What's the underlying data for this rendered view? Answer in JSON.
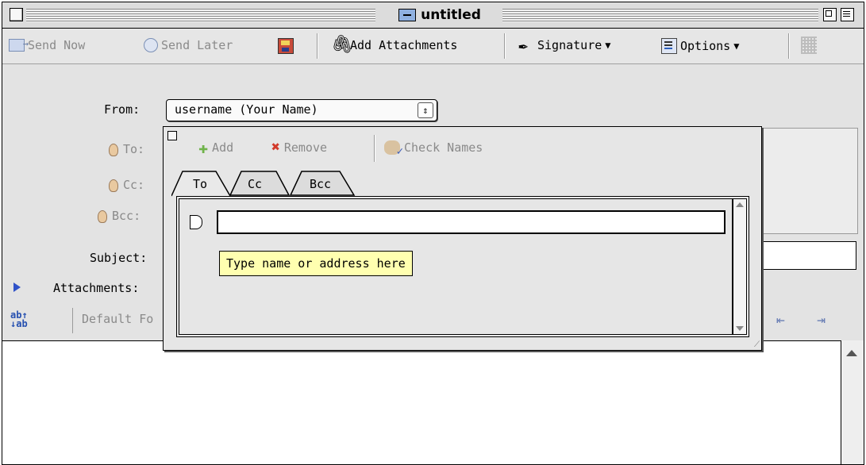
{
  "window": {
    "title": "untitled"
  },
  "toolbar": {
    "send_now": "Send Now",
    "send_later": "Send Later",
    "add_attachments": "Add Attachments",
    "signature": "Signature",
    "options": "Options",
    "dropdown_caret": "▼"
  },
  "header": {
    "from_label": "From:",
    "from_value": "username (Your Name)",
    "to_label": "To:",
    "cc_label": "Cc:",
    "bcc_label": "Bcc:",
    "subject_label": "Subject:",
    "attachments_label": "Attachments:"
  },
  "format_bar": {
    "font_value": "Default Fo"
  },
  "address_palette": {
    "add": "Add",
    "remove": "Remove",
    "check_names": "Check Names",
    "tabs": [
      {
        "label": "To"
      },
      {
        "label": "Cc"
      },
      {
        "label": "Bcc"
      }
    ],
    "active_tab": "To",
    "address_input": {
      "value": "",
      "placeholder": "Type name or address here"
    },
    "tooltip": "Type name or address here"
  },
  "icons": {
    "send_now": "send-icon",
    "send_later": "clock-icon",
    "save": "disk-icon",
    "attach": "paperclip-icon",
    "signature": "pen-icon",
    "options": "options-icon",
    "add": "plus-icon",
    "remove": "x-icon",
    "check_names": "check-names-icon"
  },
  "colors": {
    "tooltip_bg": "#ffffb0",
    "disclosure": "#2f52c8",
    "remove_red": "#d23a2a",
    "add_green": "#6fb34a"
  }
}
